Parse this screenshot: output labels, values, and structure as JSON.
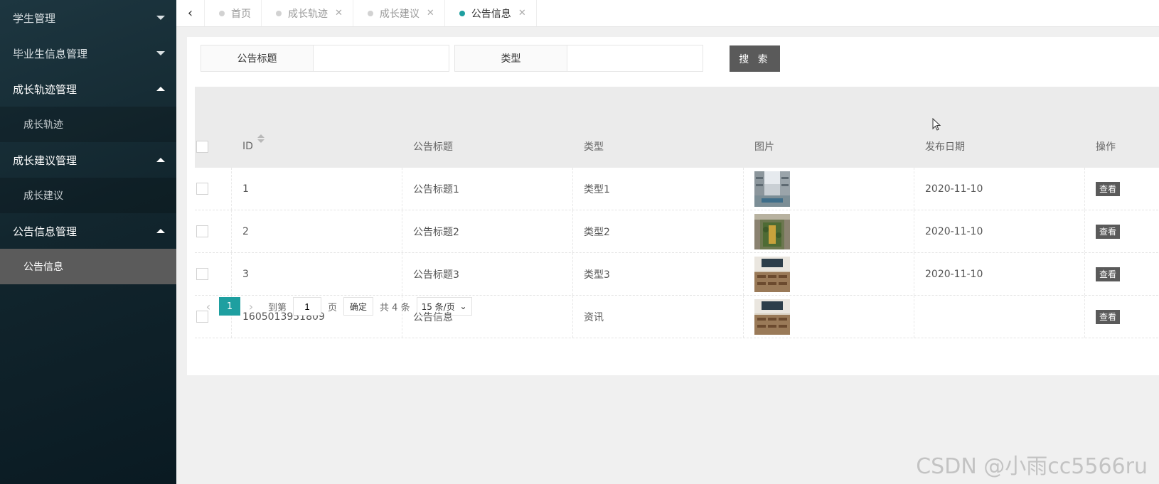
{
  "sidebar": {
    "items": [
      {
        "label": "学生管理",
        "state": "collapsed"
      },
      {
        "label": "毕业生信息管理",
        "state": "collapsed"
      },
      {
        "label": "成长轨迹管理",
        "state": "expanded",
        "sub": "成长轨迹"
      },
      {
        "label": "成长建议管理",
        "state": "expanded",
        "sub": "成长建议"
      },
      {
        "label": "公告信息管理",
        "state": "expanded",
        "sub": "公告信息"
      }
    ]
  },
  "tabs": [
    {
      "label": "首页"
    },
    {
      "label": "成长轨迹"
    },
    {
      "label": "成长建议"
    },
    {
      "label": "公告信息",
      "active": true
    }
  ],
  "search": {
    "title_label": "公告标题",
    "title_value": "",
    "type_label": "类型",
    "type_value": "",
    "button": "搜 索"
  },
  "table": {
    "headers": [
      "ID",
      "公告标题",
      "类型",
      "图片",
      "发布日期",
      "操作"
    ],
    "rows": [
      {
        "id": "1",
        "title": "公告标题1",
        "type": "类型1",
        "image": "building-atrium-photo",
        "date": "2020-11-10",
        "action": "查看"
      },
      {
        "id": "2",
        "title": "公告标题2",
        "type": "类型2",
        "image": "garden-courtyard-photo",
        "date": "2020-11-10",
        "action": "查看"
      },
      {
        "id": "3",
        "title": "公告标题3",
        "type": "类型3",
        "image": "classroom-photo",
        "date": "2020-11-10",
        "action": "查看"
      },
      {
        "id": "1605013951809",
        "title": "公告信息",
        "type": "资讯",
        "image": "classroom-photo",
        "date": "",
        "action": "查看"
      }
    ]
  },
  "pager": {
    "current": "1",
    "goto_label": "到第",
    "goto_value": "1",
    "page_unit": "页",
    "confirm": "确定",
    "total": "共 4 条",
    "page_size": "15 条/页"
  },
  "watermark": "CSDN @小雨cc5566ru",
  "colors": {
    "accent": "#1e9fa0",
    "button": "#5a5a5a",
    "sidebar": "#12262e",
    "active_menu": "#5b5b5b"
  }
}
